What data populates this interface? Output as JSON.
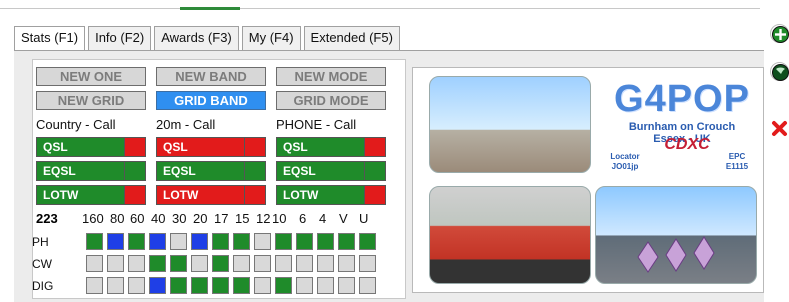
{
  "tabs": [
    {
      "label": "Stats (F1)",
      "active": true
    },
    {
      "label": "Info (F2)",
      "active": false
    },
    {
      "label": "Awards (F3)",
      "active": false
    },
    {
      "label": "My (F4)",
      "active": false
    },
    {
      "label": "Extended (F5)",
      "active": false
    }
  ],
  "buttons": {
    "new_one": "NEW ONE",
    "new_band": "NEW BAND",
    "new_mode": "NEW MODE",
    "new_grid": "NEW GRID",
    "grid_band": "GRID BAND",
    "grid_mode": "GRID MODE"
  },
  "columns": {
    "country": "Country - Call",
    "band": "20m - Call",
    "mode": "PHONE - Call"
  },
  "qsl_rows": {
    "country": [
      "QSL",
      "EQSL",
      "LOTW"
    ],
    "band": [
      "QSL",
      "EQSL",
      "LOTW"
    ],
    "mode": [
      "QSL",
      "EQSL",
      "LOTW"
    ]
  },
  "grid": {
    "count": "223",
    "bands": [
      "160",
      "80",
      "60",
      "40",
      "30",
      "20",
      "17",
      "15",
      "12",
      "10",
      "6",
      "4",
      "V",
      "U"
    ],
    "modes": [
      "PH",
      "CW",
      "DIG"
    ]
  },
  "qsl_card": {
    "callsign": "G4POP",
    "location_line1": "Burnham on Crouch",
    "location_line2": "Essex - UK",
    "locator_label": "Locator",
    "locator_value": "JO01jp",
    "club": "CDXC",
    "epc_label": "EPC",
    "epc_value": "E1115"
  },
  "colors": {
    "green": "#1f8b2a",
    "red": "#e21b1b",
    "blue": "#1f3fe6",
    "grey": "#d9d9d9",
    "accent": "#2f8ff0"
  },
  "icons": {
    "add": "plus-circle-icon",
    "globe": "globe-icon",
    "delete": "red-x-icon"
  }
}
